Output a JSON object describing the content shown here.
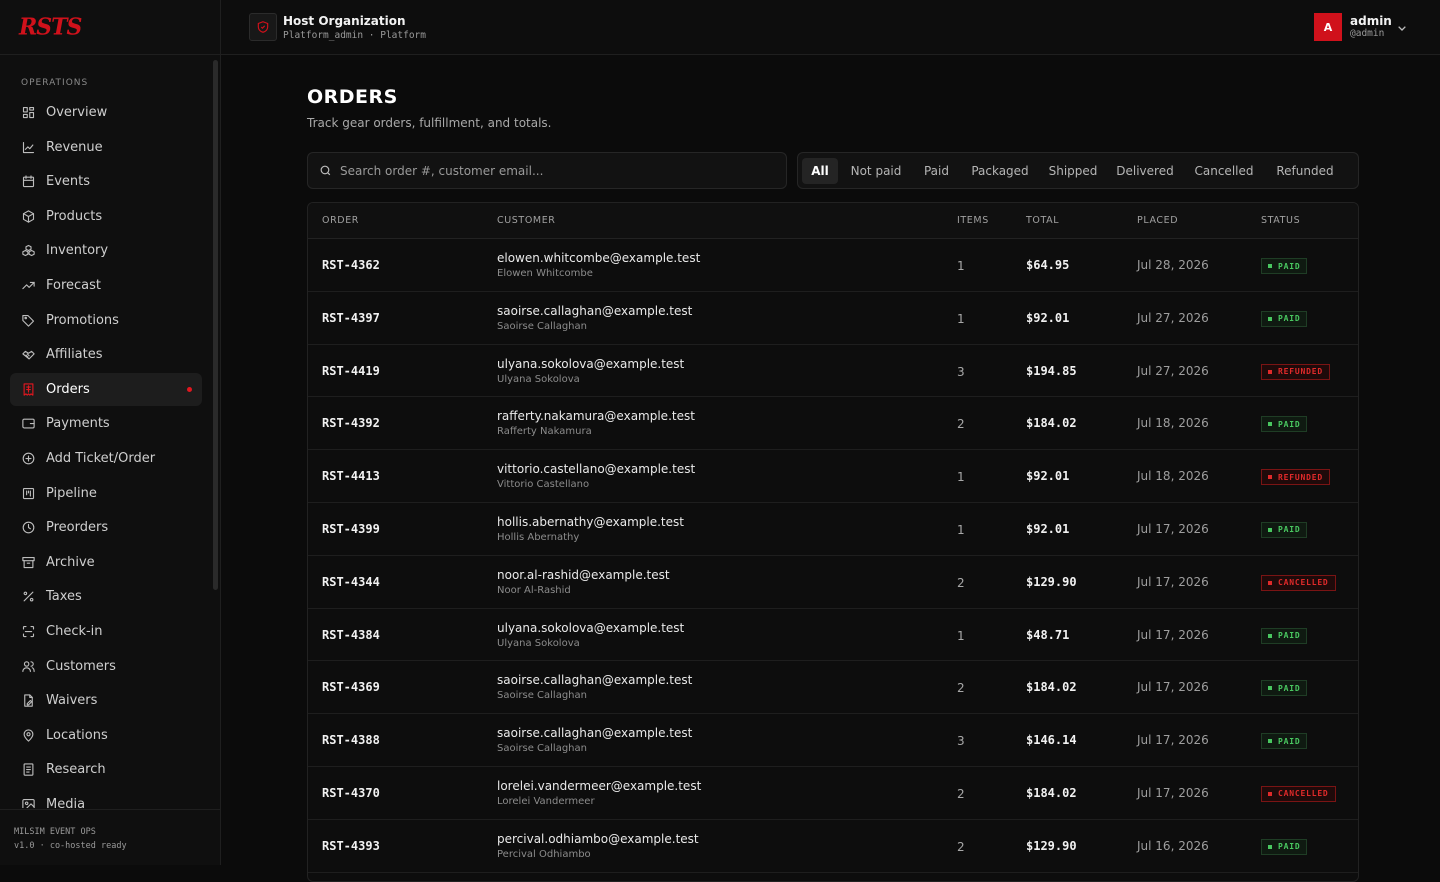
{
  "brand": {
    "logo_text": "RSTS"
  },
  "sidebar": {
    "section_label": "OPERATIONS",
    "items": [
      {
        "label": "Overview",
        "icon": "grid-icon"
      },
      {
        "label": "Revenue",
        "icon": "line-chart-icon"
      },
      {
        "label": "Events",
        "icon": "calendar-icon"
      },
      {
        "label": "Products",
        "icon": "box-icon"
      },
      {
        "label": "Inventory",
        "icon": "boxes-icon"
      },
      {
        "label": "Forecast",
        "icon": "trending-up-icon"
      },
      {
        "label": "Promotions",
        "icon": "tag-icon"
      },
      {
        "label": "Affiliates",
        "icon": "handshake-icon"
      },
      {
        "label": "Orders",
        "icon": "receipt-icon",
        "active": true
      },
      {
        "label": "Payments",
        "icon": "wallet-icon"
      },
      {
        "label": "Add Ticket/Order",
        "icon": "plus-circle-icon"
      },
      {
        "label": "Pipeline",
        "icon": "kanban-icon"
      },
      {
        "label": "Preorders",
        "icon": "clock-icon"
      },
      {
        "label": "Archive",
        "icon": "archive-icon"
      },
      {
        "label": "Taxes",
        "icon": "percent-icon"
      },
      {
        "label": "Check-in",
        "icon": "scan-icon"
      },
      {
        "label": "Customers",
        "icon": "users-icon"
      },
      {
        "label": "Waivers",
        "icon": "document-pen-icon"
      },
      {
        "label": "Locations",
        "icon": "map-pin-icon"
      },
      {
        "label": "Research",
        "icon": "notebook-icon"
      },
      {
        "label": "Media",
        "icon": "image-icon"
      }
    ],
    "footer_line1": "MILSIM EVENT OPS",
    "footer_line2": "v1.0 · co-hosted ready"
  },
  "topbar": {
    "org_name": "Host Organization",
    "org_sub": "Platform_admin · Platform",
    "avatar_letter": "A",
    "user_name": "admin",
    "user_handle": "@admin"
  },
  "page": {
    "title": "ORDERS",
    "subtitle": "Track gear orders, fulfillment, and totals.",
    "search_placeholder": "Search order #, customer email..."
  },
  "filters": [
    "All",
    "Not paid",
    "Paid",
    "Packaged",
    "Shipped",
    "Delivered",
    "Cancelled",
    "Refunded"
  ],
  "active_filter": "All",
  "table": {
    "headers": [
      "ORDER",
      "CUSTOMER",
      "ITEMS",
      "TOTAL",
      "PLACED",
      "STATUS"
    ],
    "rows": [
      {
        "order": "RST-4362",
        "email": "elowen.whitcombe@example.test",
        "name": "Elowen Whitcombe",
        "items": "1",
        "total": "$64.95",
        "placed": "Jul 28, 2026",
        "status": "PAID"
      },
      {
        "order": "RST-4397",
        "email": "saoirse.callaghan@example.test",
        "name": "Saoirse Callaghan",
        "items": "1",
        "total": "$92.01",
        "placed": "Jul 27, 2026",
        "status": "PAID"
      },
      {
        "order": "RST-4419",
        "email": "ulyana.sokolova@example.test",
        "name": "Ulyana Sokolova",
        "items": "3",
        "total": "$194.85",
        "placed": "Jul 27, 2026",
        "status": "REFUNDED"
      },
      {
        "order": "RST-4392",
        "email": "rafferty.nakamura@example.test",
        "name": "Rafferty Nakamura",
        "items": "2",
        "total": "$184.02",
        "placed": "Jul 18, 2026",
        "status": "PAID"
      },
      {
        "order": "RST-4413",
        "email": "vittorio.castellano@example.test",
        "name": "Vittorio Castellano",
        "items": "1",
        "total": "$92.01",
        "placed": "Jul 18, 2026",
        "status": "REFUNDED"
      },
      {
        "order": "RST-4399",
        "email": "hollis.abernathy@example.test",
        "name": "Hollis Abernathy",
        "items": "1",
        "total": "$92.01",
        "placed": "Jul 17, 2026",
        "status": "PAID"
      },
      {
        "order": "RST-4344",
        "email": "noor.al-rashid@example.test",
        "name": "Noor Al-Rashid",
        "items": "2",
        "total": "$129.90",
        "placed": "Jul 17, 2026",
        "status": "CANCELLED"
      },
      {
        "order": "RST-4384",
        "email": "ulyana.sokolova@example.test",
        "name": "Ulyana Sokolova",
        "items": "1",
        "total": "$48.71",
        "placed": "Jul 17, 2026",
        "status": "PAID"
      },
      {
        "order": "RST-4369",
        "email": "saoirse.callaghan@example.test",
        "name": "Saoirse Callaghan",
        "items": "2",
        "total": "$184.02",
        "placed": "Jul 17, 2026",
        "status": "PAID"
      },
      {
        "order": "RST-4388",
        "email": "saoirse.callaghan@example.test",
        "name": "Saoirse Callaghan",
        "items": "3",
        "total": "$146.14",
        "placed": "Jul 17, 2026",
        "status": "PAID"
      },
      {
        "order": "RST-4370",
        "email": "lorelei.vandermeer@example.test",
        "name": "Lorelei Vandermeer",
        "items": "2",
        "total": "$184.02",
        "placed": "Jul 17, 2026",
        "status": "CANCELLED"
      },
      {
        "order": "RST-4393",
        "email": "percival.odhiambo@example.test",
        "name": "Percival Odhiambo",
        "items": "2",
        "total": "$129.90",
        "placed": "Jul 16, 2026",
        "status": "PAID"
      }
    ]
  },
  "colors": {
    "accent": "#d0111b",
    "paid": "#49c760",
    "refunded": "#e02a2a"
  }
}
